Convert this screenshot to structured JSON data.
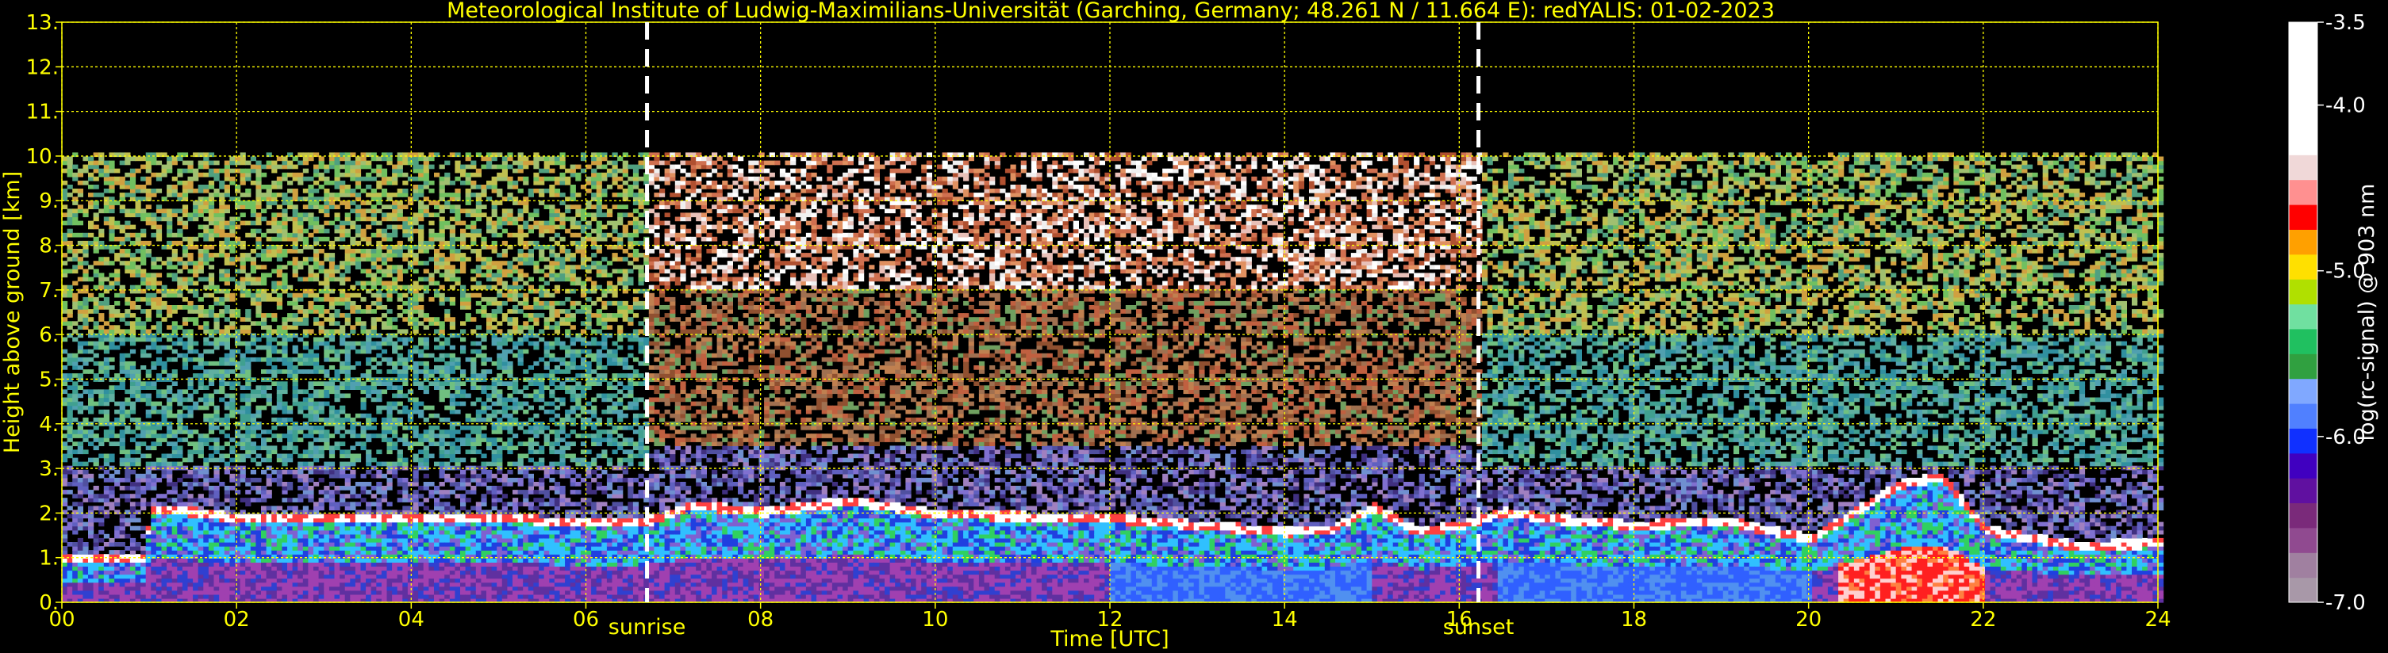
{
  "chart_data": {
    "type": "heatmap",
    "title": "Meteorological Institute of Ludwig-Maximilians-Universität (Garching, Germany; 48.261 N / 11.664 E):    redYALIS: 01-02-2023",
    "xlabel": "Time [UTC]",
    "ylabel": "Height above ground [km]",
    "xlim": [
      0,
      24
    ],
    "ylim": [
      0,
      13
    ],
    "x_ticks": [
      "00",
      "02",
      "04",
      "06",
      "08",
      "10",
      "12",
      "14",
      "16",
      "18",
      "20",
      "22",
      "24"
    ],
    "y_ticks": [
      "0.",
      "1.",
      "2.",
      "3.",
      "4.",
      "5.",
      "6.",
      "7.",
      "8.",
      "9.",
      "10.",
      "11.",
      "12.",
      "13."
    ],
    "grid": true,
    "markers": [
      {
        "label": "sunrise",
        "x": 6.7
      },
      {
        "label": "sunset",
        "x": 16.22
      }
    ],
    "data_max_height_km": 10,
    "colorbar": {
      "label": "log(rc-signal) @ 903 nm",
      "range": [
        -7.0,
        -3.5
      ],
      "ticks": [
        "-3.5",
        "-4.0",
        "-5.0",
        "-6.0",
        "-7.0"
      ],
      "tick_values": [
        -3.5,
        -4.0,
        -5.0,
        -6.0,
        -7.0
      ]
    },
    "boundary_layer_top_km": [
      [
        0.0,
        0.95
      ],
      [
        0.9,
        0.95
      ],
      [
        1.0,
        2.05
      ],
      [
        1.5,
        2.0
      ],
      [
        2.0,
        1.85
      ],
      [
        3.0,
        1.9
      ],
      [
        4.0,
        1.85
      ],
      [
        5.0,
        1.9
      ],
      [
        5.5,
        1.8
      ],
      [
        6.0,
        1.75
      ],
      [
        6.7,
        1.8
      ],
      [
        7.2,
        2.15
      ],
      [
        8.0,
        2.0
      ],
      [
        9.0,
        2.25
      ],
      [
        10.0,
        1.95
      ],
      [
        11.0,
        1.9
      ],
      [
        12.0,
        1.85
      ],
      [
        13.0,
        1.7
      ],
      [
        14.0,
        1.55
      ],
      [
        14.5,
        1.6
      ],
      [
        15.0,
        2.1
      ],
      [
        15.5,
        1.55
      ],
      [
        16.0,
        1.7
      ],
      [
        16.5,
        2.0
      ],
      [
        17.0,
        1.85
      ],
      [
        18.0,
        1.7
      ],
      [
        19.0,
        1.8
      ],
      [
        20.0,
        1.4
      ],
      [
        21.0,
        2.6
      ],
      [
        21.5,
        2.8
      ],
      [
        22.0,
        1.6
      ],
      [
        23.0,
        1.25
      ],
      [
        24.0,
        1.3
      ]
    ],
    "rain_cells": [
      {
        "x": [
          20.3,
          22.0
        ],
        "top_km": 1.2
      },
      {
        "x": [
          0.6,
          1.3
        ],
        "top_km": 0.9
      }
    ],
    "colors": {
      "axis_text": "#ffff00",
      "grid": "#ffff00",
      "marker_line": "#ffffff",
      "colorbar_text": "#ffffff"
    }
  }
}
